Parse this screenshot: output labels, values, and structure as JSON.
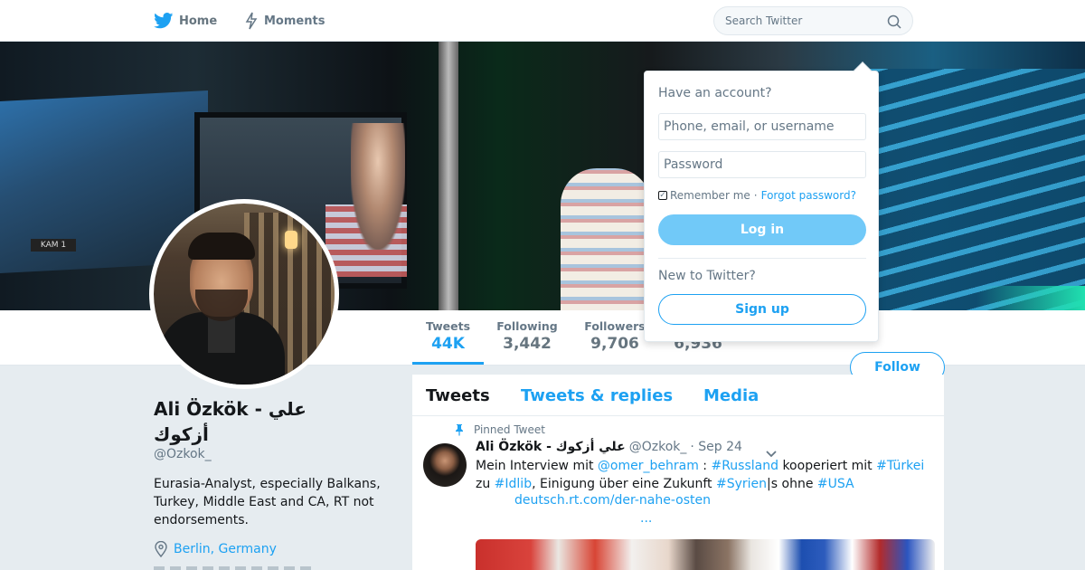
{
  "nav": {
    "home_label": "Home",
    "moments_label": "Moments",
    "search_placeholder": "Search Twitter",
    "icons": {
      "home": "twitter-bird-icon",
      "moments": "lightning-icon",
      "search": "search-icon"
    }
  },
  "banner": {
    "kam_label": "KAM 1"
  },
  "stats": {
    "tweets": {
      "label": "Tweets",
      "value": "44K"
    },
    "following": {
      "label": "Following",
      "value": "3,442"
    },
    "followers": {
      "label": "Followers",
      "value": "9,706"
    },
    "likes": {
      "value": "6,936"
    }
  },
  "follow_label": "Follow",
  "profile": {
    "name": "Ali Özkök - علي أزكوك",
    "handle": "@Ozkok_",
    "bio": "Eurasia-Analyst, especially Balkans, Turkey, Middle East and CA, RT not endorsements.",
    "location": "Berlin, Germany"
  },
  "timeline": {
    "tabs": [
      "Tweets",
      "Tweets & replies",
      "Media"
    ],
    "active_tab": "Tweets",
    "pinned_label": "Pinned Tweet",
    "tweet": {
      "name": "Ali Özkök - علي أزكوك",
      "handle": "@Ozkok_",
      "time": "· Sep 24",
      "line1": {
        "t1": "Mein Interview mit ",
        "mention": "@omer_behram",
        "t2": " : ",
        "hashtag1": "#Russland",
        "t3": " kooperiert mit ",
        "hashtag2": "#Türkei"
      },
      "line2": {
        "t1": "zu ",
        "hashtag1": "#Idlib",
        "t2": ", Einigung über eine Zukunft ",
        "hashtag2": "#Syrien",
        "t3": "|s ohne ",
        "hashtag3": "#USA"
      },
      "url": "deutsch.rt.com/der-nahe-osten",
      "ellipsis": "..."
    }
  },
  "login": {
    "have_account": "Have an account?",
    "username_placeholder": "Phone, email, or username",
    "password_placeholder": "Password",
    "remember_label": "Remember me",
    "separator": "·",
    "forgot_label": "Forgot password?",
    "login_label": "Log in",
    "new_label": "New to Twitter?",
    "signup_label": "Sign up",
    "remember_checked": true
  },
  "colors": {
    "accent": "#1da1f2",
    "text": "#14171a",
    "muted": "#657786",
    "background": "#e6ecf0"
  }
}
